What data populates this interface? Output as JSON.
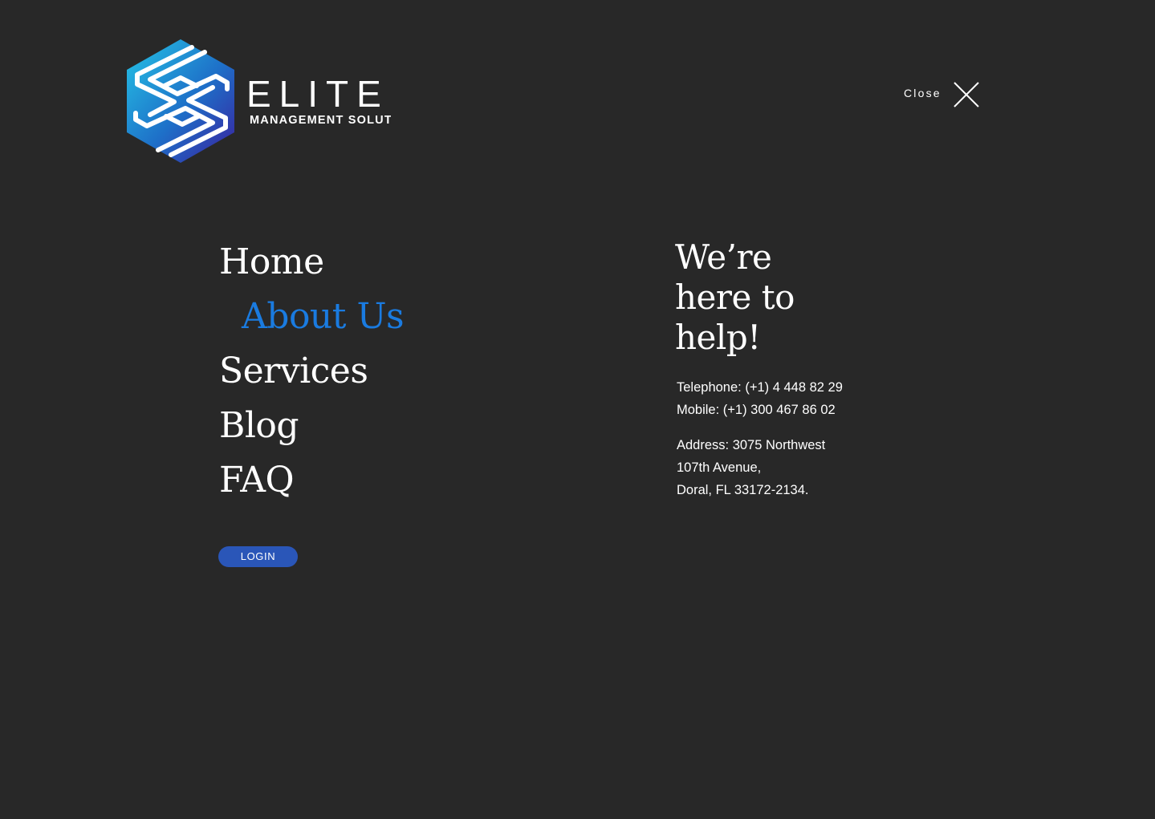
{
  "header": {
    "logo": {
      "name": "ELITE",
      "tagline": "MANAGEMENT SOLUTION",
      "colors": {
        "cyan": "#25c5e6",
        "blue": "#1e6fc8",
        "indigo": "#3a1f9e"
      }
    },
    "close_label": "Close",
    "close_icon": "close-icon"
  },
  "nav": {
    "items": [
      {
        "label": "Home"
      },
      {
        "label": "About Us"
      },
      {
        "label": "Services"
      },
      {
        "label": "Blog"
      },
      {
        "label": "FAQ"
      }
    ],
    "active_item": "About Us",
    "active_color": "#1a7be0",
    "login_label": "LOGIN",
    "login_color": "#2a56b8"
  },
  "help": {
    "heading_lines": [
      "We’re",
      "here to",
      "help!"
    ],
    "telephone": "Telephone: (+1) 4 448 82 29",
    "mobile": "Mobile: (+1) 300 467 86 02",
    "address_lines": [
      "Address: 3075 Northwest",
      "107th Avenue,",
      "Doral, FL 33172-2134."
    ]
  },
  "theme": {
    "background": "#282828",
    "text": "#ffffff"
  }
}
